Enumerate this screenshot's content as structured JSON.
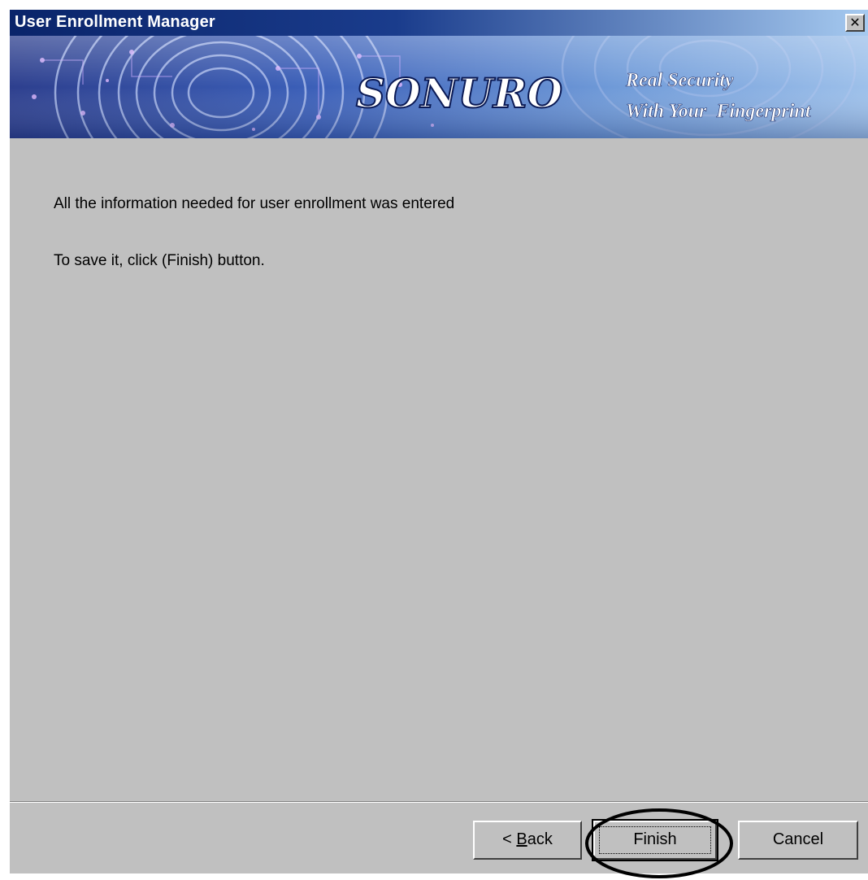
{
  "window": {
    "title": "User Enrollment Manager",
    "close_glyph": "✕",
    "close_icon": "close-icon"
  },
  "banner": {
    "brand": "SONURO",
    "tagline_line1": "Real Security",
    "tagline_line2": "With Your  Fingerprint"
  },
  "content": {
    "message_line1": "All the information needed for user enrollment was entered",
    "message_line2": "To save it, click (Finish) button."
  },
  "buttons": {
    "back_prefix": "< ",
    "back_mnemonic": "B",
    "back_rest": "ack",
    "finish_label": "Finish",
    "cancel_label": "Cancel"
  },
  "colors": {
    "window_face": "#c0c0c0",
    "titlebar_start": "#0a246a",
    "titlebar_end": "#a6caf0",
    "banner_blue": "#2b4fa8",
    "annotation_ring": "#000000"
  }
}
